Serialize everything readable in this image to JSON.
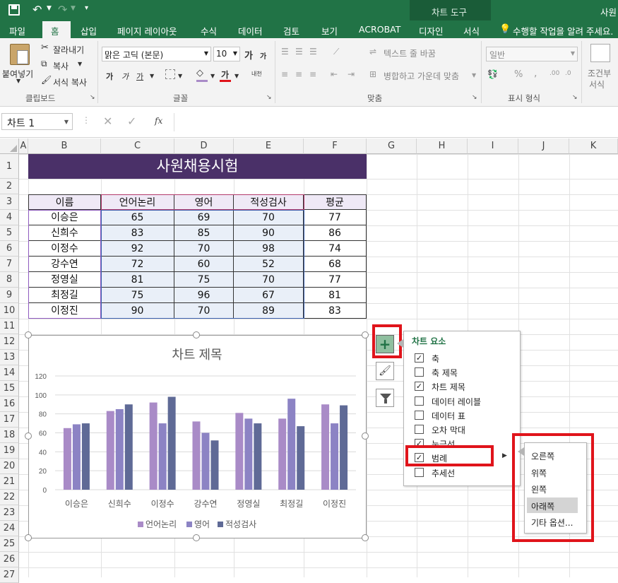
{
  "titlebar": {
    "chart_tools": "차트 도구",
    "doc_title": "사원"
  },
  "tabs": [
    "파일",
    "홈",
    "삽입",
    "페이지 레이아웃",
    "수식",
    "데이터",
    "검토",
    "보기",
    "ACROBAT",
    "디자인",
    "서식"
  ],
  "tell_me": "수행할 작업을 알려 주세요.",
  "ribbon": {
    "paste": "붙여넣기",
    "cut": "잘라내기",
    "copy": "복사",
    "format_painter": "서식 복사",
    "clipboard": "클립보드",
    "font_name": "맑은 고딕 (본문)",
    "font_size": "10",
    "font_group": "글꼴",
    "wrap_text": "텍스트 줄 바꿈",
    "merge_center": "병합하고 가운데 맞춤",
    "alignment_group": "맞춤",
    "number_format": "일반",
    "number_group": "표시 형식",
    "conditional": "조건부",
    "conditional2": "서식",
    "bold": "가",
    "italic": "가",
    "underline": "가",
    "grow": "가",
    "shrink": "가",
    "fontcolor": "가",
    "phonetic": "내천",
    "percent": "%",
    "comma": ","
  },
  "namebox": "차트 1",
  "fx": "fx",
  "columns": [
    "A",
    "B",
    "C",
    "D",
    "E",
    "F",
    "G",
    "H",
    "I",
    "J",
    "K"
  ],
  "rows": [
    "1",
    "2",
    "3",
    "4",
    "5",
    "6",
    "7",
    "8",
    "9",
    "10",
    "11",
    "12",
    "13",
    "14",
    "15",
    "16",
    "17",
    "18",
    "19",
    "20",
    "21",
    "22",
    "23",
    "24",
    "25",
    "26",
    "27"
  ],
  "sheet": {
    "title": "사원채용시험",
    "headers": [
      "이름",
      "언어논리",
      "영어",
      "적성검사",
      "평균"
    ],
    "data": [
      [
        "이승은",
        "65",
        "69",
        "70",
        "77"
      ],
      [
        "신희수",
        "83",
        "85",
        "90",
        "86"
      ],
      [
        "이정수",
        "92",
        "70",
        "98",
        "74"
      ],
      [
        "강수연",
        "72",
        "60",
        "52",
        "68"
      ],
      [
        "정영실",
        "81",
        "75",
        "70",
        "77"
      ],
      [
        "최정길",
        "75",
        "96",
        "67",
        "81"
      ],
      [
        "이정진",
        "90",
        "70",
        "89",
        "83"
      ]
    ]
  },
  "chart_data": {
    "type": "bar",
    "title": "차트 제목",
    "categories": [
      "이승은",
      "신희수",
      "이정수",
      "강수연",
      "정영실",
      "최정길",
      "이정진"
    ],
    "series": [
      {
        "name": "언어논리",
        "values": [
          65,
          83,
          92,
          72,
          81,
          75,
          90
        ],
        "color": "#a98bc7"
      },
      {
        "name": "영어",
        "values": [
          69,
          85,
          70,
          60,
          75,
          96,
          70
        ],
        "color": "#8c83c4"
      },
      {
        "name": "적성검사",
        "values": [
          70,
          90,
          98,
          52,
          70,
          67,
          89
        ],
        "color": "#5f6a96"
      }
    ],
    "ylim": [
      0,
      120
    ],
    "yticks": [
      "120",
      "100",
      "80",
      "60",
      "40",
      "20",
      "0"
    ],
    "legend_position": "bottom",
    "grid": true
  },
  "chart_elements": {
    "header": "차트 요소",
    "items": [
      {
        "label": "축",
        "checked": "✓"
      },
      {
        "label": "축 제목",
        "checked": ""
      },
      {
        "label": "차트 제목",
        "checked": "✓"
      },
      {
        "label": "데이터 레이블",
        "checked": ""
      },
      {
        "label": "데이터 표",
        "checked": ""
      },
      {
        "label": "오차 막대",
        "checked": ""
      },
      {
        "label": "눈금선",
        "checked": "✓"
      },
      {
        "label": "범례",
        "checked": "✓"
      },
      {
        "label": "추세선",
        "checked": ""
      }
    ]
  },
  "legend_submenu": [
    "오른쪽",
    "위쪽",
    "왼쪽",
    "아래쪽",
    "기타 옵션..."
  ],
  "colors": {
    "excel_green": "#217346",
    "title_bg": "#4a3068",
    "header_bg": "#efe9f6",
    "highlight": "#e0141b"
  }
}
